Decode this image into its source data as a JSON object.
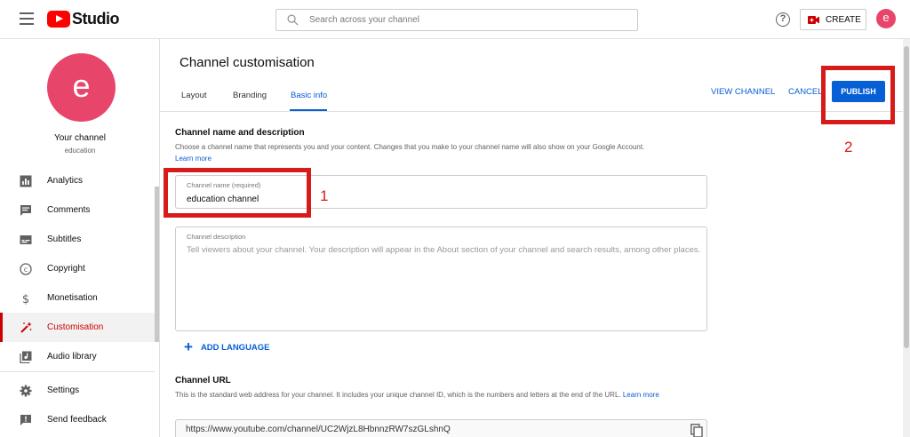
{
  "header": {
    "logo_text": "Studio",
    "search_placeholder": "Search across your channel",
    "help_label": "?",
    "create_label": "CREATE",
    "avatar_letter": "e"
  },
  "sidebar": {
    "avatar_letter": "e",
    "your_channel": "Your channel",
    "channel_name": "education",
    "items": [
      {
        "label": "Analytics",
        "icon": "analytics-icon"
      },
      {
        "label": "Comments",
        "icon": "comments-icon"
      },
      {
        "label": "Subtitles",
        "icon": "subtitles-icon"
      },
      {
        "label": "Copyright",
        "icon": "copyright-icon"
      },
      {
        "label": "Monetisation",
        "icon": "dollar-icon"
      },
      {
        "label": "Customisation",
        "icon": "magic-wand-icon",
        "active": true
      },
      {
        "label": "Audio library",
        "icon": "audio-library-icon"
      },
      {
        "label": "Settings",
        "icon": "gear-icon"
      },
      {
        "label": "Send feedback",
        "icon": "feedback-icon"
      }
    ]
  },
  "main": {
    "title": "Channel customisation",
    "tabs": [
      "Layout",
      "Branding",
      "Basic info"
    ],
    "active_tab": "Basic info",
    "view_channel": "VIEW CHANNEL",
    "cancel": "CANCEL",
    "publish": "PUBLISH",
    "name_section": {
      "title": "Channel name and description",
      "desc": "Choose a channel name that represents you and your content. Changes that you make to your channel name will also show on your Google Account.",
      "learn_more": "Learn more",
      "name_label": "Channel name (required)",
      "name_value": "education channel",
      "desc_label": "Channel description",
      "desc_placeholder": "Tell viewers about your channel. Your description will appear in the About section of your channel and search results, among other places.",
      "add_language": "ADD LANGUAGE"
    },
    "url_section": {
      "title": "Channel URL",
      "desc": "This is the standard web address for your channel. It includes your unique channel ID, which is the numbers and letters at the end of the URL.",
      "learn_more": "Learn more",
      "url": "https://www.youtube.com/channel/UC2WjzL8HbnnzRW7szGLshnQ"
    }
  },
  "annotations": {
    "one": "1",
    "two": "2",
    "color": "#d71b1b"
  },
  "colors": {
    "accent": "#065fd4",
    "brand": "#ff0000",
    "active_nav": "#cc0000",
    "avatar": "#e8456b"
  }
}
